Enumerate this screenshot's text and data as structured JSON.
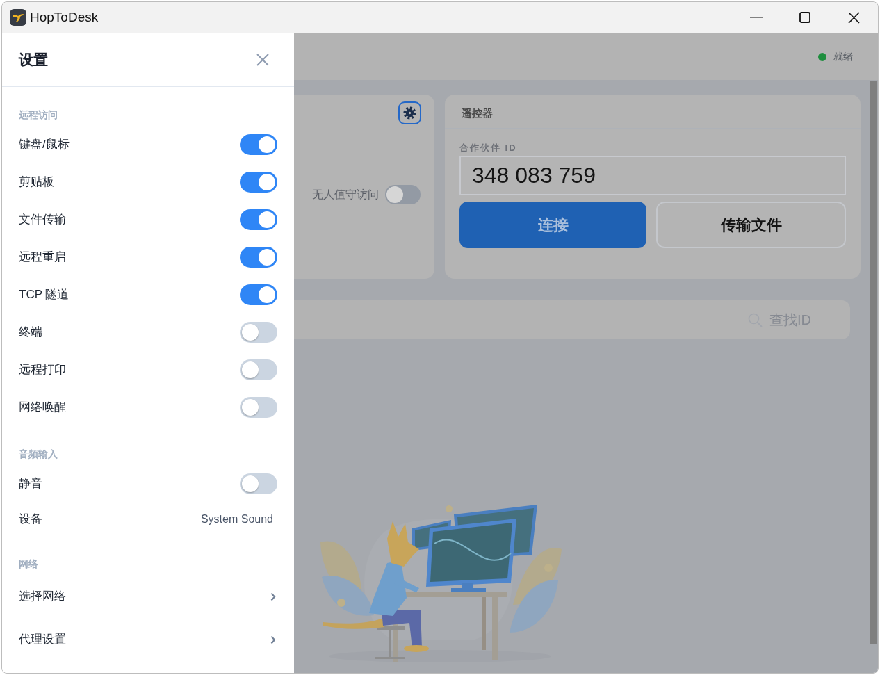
{
  "window": {
    "title": "HopToDesk"
  },
  "settings_drawer": {
    "title": "设置",
    "sections": [
      {
        "heading": "远程访问",
        "items": [
          {
            "kind": "toggle",
            "label": "键盘/鼠标",
            "on": true
          },
          {
            "kind": "toggle",
            "label": "剪贴板",
            "on": true
          },
          {
            "kind": "toggle",
            "label": "文件传输",
            "on": true
          },
          {
            "kind": "toggle",
            "label": "远程重启",
            "on": true
          },
          {
            "kind": "toggle",
            "label": "TCP 隧道",
            "on": true
          },
          {
            "kind": "toggle",
            "label": "终端",
            "on": false
          },
          {
            "kind": "toggle",
            "label": "远程打印",
            "on": false
          },
          {
            "kind": "toggle",
            "label": "网络唤醒",
            "on": false
          }
        ]
      },
      {
        "heading": "音频输入",
        "items": [
          {
            "kind": "toggle",
            "label": "静音",
            "on": false
          },
          {
            "kind": "value",
            "label": "设备",
            "value": "System Sound"
          }
        ]
      },
      {
        "heading": "网络",
        "items": [
          {
            "kind": "link",
            "label": "选择网络"
          },
          {
            "kind": "link",
            "label": "代理设置"
          }
        ]
      }
    ]
  },
  "app": {
    "status": {
      "label": "就绪",
      "online": true
    },
    "access_card": {
      "unattended_access": {
        "label": "无人值守访问",
        "on": false
      }
    },
    "remote_card": {
      "title": "遥控器",
      "partner_id_label": "合作伙伴 ID",
      "partner_id": "348 083 759",
      "buttons": [
        {
          "kind": "primary",
          "label": "连接"
        },
        {
          "kind": "secondary",
          "label": "传输文件"
        }
      ]
    },
    "search": {
      "placeholder": "查找ID"
    }
  }
}
